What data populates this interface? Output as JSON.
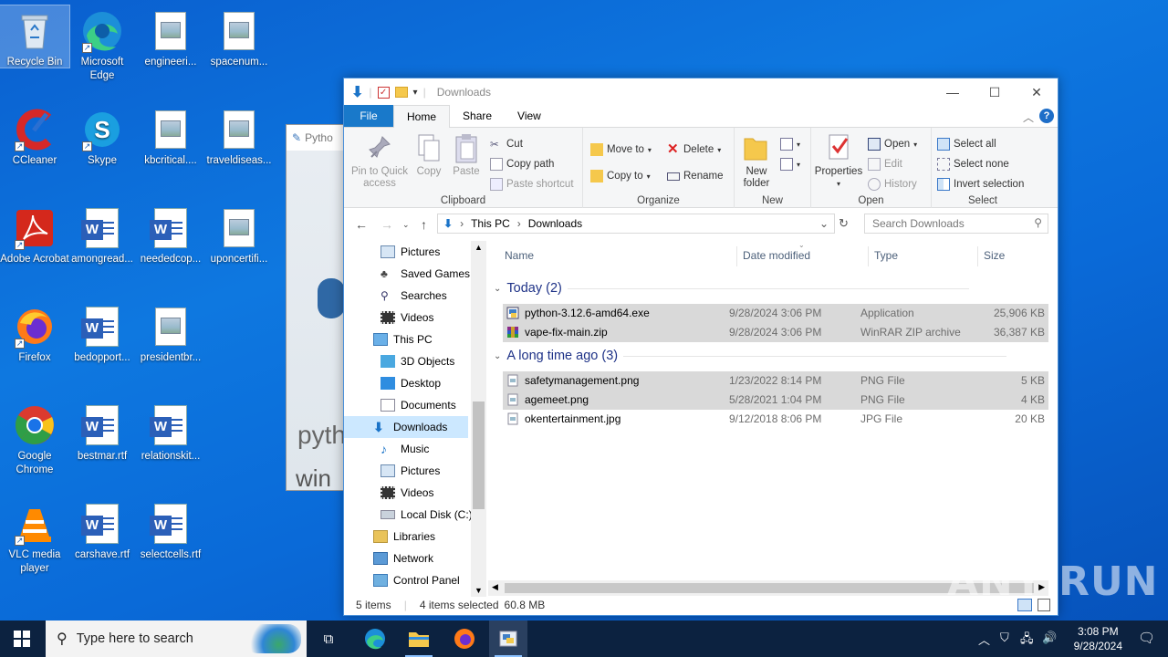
{
  "desktop": {
    "icons": [
      {
        "label": "Recycle Bin"
      },
      {
        "label": "Microsoft Edge"
      },
      {
        "label": "engineeri..."
      },
      {
        "label": "spacenum..."
      },
      {
        "label": "CCleaner"
      },
      {
        "label": "Skype"
      },
      {
        "label": "kbcritical...."
      },
      {
        "label": "traveldiseas..."
      },
      {
        "label": "Adobe Acrobat"
      },
      {
        "label": "amongread..."
      },
      {
        "label": "neededcop..."
      },
      {
        "label": "uponcertifi..."
      },
      {
        "label": "Firefox"
      },
      {
        "label": "bedopport..."
      },
      {
        "label": "presidentbr..."
      },
      {
        "label": "Google Chrome"
      },
      {
        "label": "bestmar.rtf"
      },
      {
        "label": "relationskit..."
      },
      {
        "label": "VLC media player"
      },
      {
        "label": "carshave.rtf"
      },
      {
        "label": "selectcells.rtf"
      }
    ],
    "background_window_title": "Pytho",
    "watermark": "ANY RUN"
  },
  "explorer": {
    "title": "Downloads",
    "tabs": {
      "file": "File",
      "home": "Home",
      "share": "Share",
      "view": "View"
    },
    "clipboard": {
      "pin": "Pin to Quick access",
      "copy": "Copy",
      "paste": "Paste",
      "cut": "Cut",
      "copy_path": "Copy path",
      "paste_shortcut": "Paste shortcut",
      "label": "Clipboard"
    },
    "organize": {
      "move_to": "Move to",
      "copy_to": "Copy to",
      "delete": "Delete",
      "rename": "Rename",
      "label": "Organize"
    },
    "new": {
      "new_folder": "New folder",
      "label": "New"
    },
    "open": {
      "properties": "Properties",
      "open": "Open",
      "edit": "Edit",
      "history": "History",
      "label": "Open"
    },
    "select": {
      "select_all": "Select all",
      "select_none": "Select none",
      "invert": "Invert selection",
      "label": "Select"
    },
    "address": {
      "this_pc": "This PC",
      "downloads": "Downloads"
    },
    "search_placeholder": "Search Downloads",
    "nav": [
      {
        "label": "Pictures"
      },
      {
        "label": "Saved Games"
      },
      {
        "label": "Searches"
      },
      {
        "label": "Videos"
      },
      {
        "label": "This PC"
      },
      {
        "label": "3D Objects"
      },
      {
        "label": "Desktop"
      },
      {
        "label": "Documents"
      },
      {
        "label": "Downloads"
      },
      {
        "label": "Music"
      },
      {
        "label": "Pictures"
      },
      {
        "label": "Videos"
      },
      {
        "label": "Local Disk (C:)"
      },
      {
        "label": "Libraries"
      },
      {
        "label": "Network"
      },
      {
        "label": "Control Panel"
      }
    ],
    "columns": {
      "name": "Name",
      "date": "Date modified",
      "type": "Type",
      "size": "Size"
    },
    "groups": [
      {
        "title": "Today (2)",
        "files": [
          {
            "name": "python-3.12.6-amd64.exe",
            "date": "9/28/2024 3:06 PM",
            "type": "Application",
            "size": "25,906 KB"
          },
          {
            "name": "vape-fix-main.zip",
            "date": "9/28/2024 3:06 PM",
            "type": "WinRAR ZIP archive",
            "size": "36,387 KB"
          }
        ]
      },
      {
        "title": "A long time ago (3)",
        "files": [
          {
            "name": "safetymanagement.png",
            "date": "1/23/2022 8:14 PM",
            "type": "PNG File",
            "size": "5 KB"
          },
          {
            "name": "agemeet.png",
            "date": "5/28/2021 1:04 PM",
            "type": "PNG File",
            "size": "4 KB"
          },
          {
            "name": "okentertainment.jpg",
            "date": "9/12/2018 8:06 PM",
            "type": "JPG File",
            "size": "20 KB"
          }
        ]
      }
    ],
    "status": {
      "items": "5 items",
      "selected": "4 items selected",
      "size": "60.8 MB"
    }
  },
  "taskbar": {
    "search_placeholder": "Type here to search",
    "time": "3:08 PM",
    "date": "9/28/2024"
  }
}
